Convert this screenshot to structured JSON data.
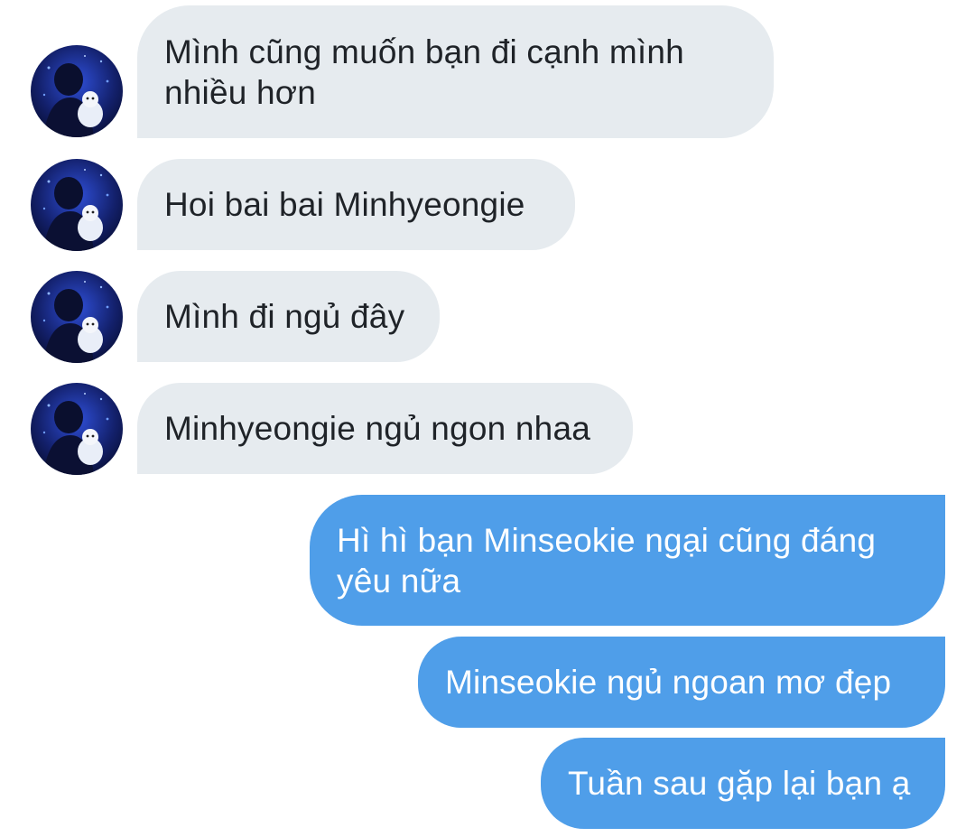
{
  "chat": {
    "incoming": [
      {
        "text": "Mình cũng muốn bạn đi cạnh mình nhiều hơn"
      },
      {
        "text": "Hoi bai bai Minhyeongie"
      },
      {
        "text": "Mình đi ngủ đây"
      },
      {
        "text": "Minhyeongie ngủ ngon nhaa"
      }
    ],
    "outgoing": [
      {
        "text": "Hì hì bạn Minseokie ngại cũng đáng yêu nữa"
      },
      {
        "text": "Minseokie ngủ ngoan mơ đẹp"
      },
      {
        "text": "Tuần sau gặp lại bạn ạ"
      }
    ],
    "colors": {
      "incoming_bubble": "#e6ebef",
      "outgoing_bubble": "#4f9ee9",
      "incoming_text": "#1f2328",
      "outgoing_text": "#ffffff"
    },
    "avatar": {
      "icon": "user-avatar-photo"
    }
  }
}
